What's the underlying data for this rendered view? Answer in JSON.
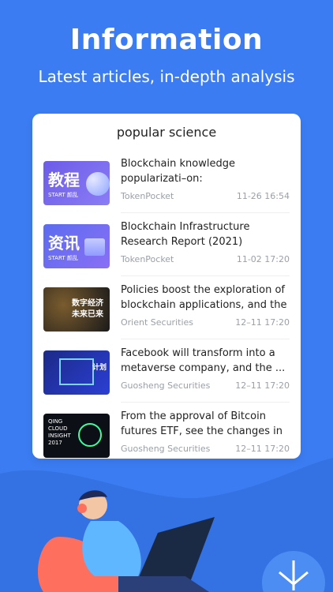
{
  "header": {
    "title": "Information",
    "subtitle": "Latest articles, in-depth analysis"
  },
  "card": {
    "title": "popular science",
    "items": [
      {
        "title": "Blockchain knowledge popularizati–on: Polkadot(Polkadot) topic",
        "source": "TokenPocket",
        "time": "11-26 16:54",
        "thumb_text": "教程",
        "thumb_sub": "START 颜乱"
      },
      {
        "title": "Blockchain Infrastructure Research Report (2021)",
        "source": "TokenPocket",
        "time": "11-02 17:20",
        "thumb_text": "资讯",
        "thumb_sub": "START 颜乱"
      },
      {
        "title": "Policies boost the exploration of blockchain applications, and the ...",
        "source": "Orient Securities",
        "time": "12–11 17:20",
        "thumb_text": "数字经济 未来已来"
      },
      {
        "title": "Facebook will transform into a metaverse company, and the ...",
        "source": "Guosheng Securities",
        "time": "12–11 17:20",
        "thumb_text": "计划"
      },
      {
        "title": "From the approval of Bitcoin futures ETF, see the changes in ...",
        "source": "Guosheng Securities",
        "time": "12–11 17:20",
        "thumb_text": "QING CLOUD INSIGHT 2017"
      }
    ]
  },
  "colors": {
    "background": "#3b7cf2",
    "card": "#ffffff"
  }
}
